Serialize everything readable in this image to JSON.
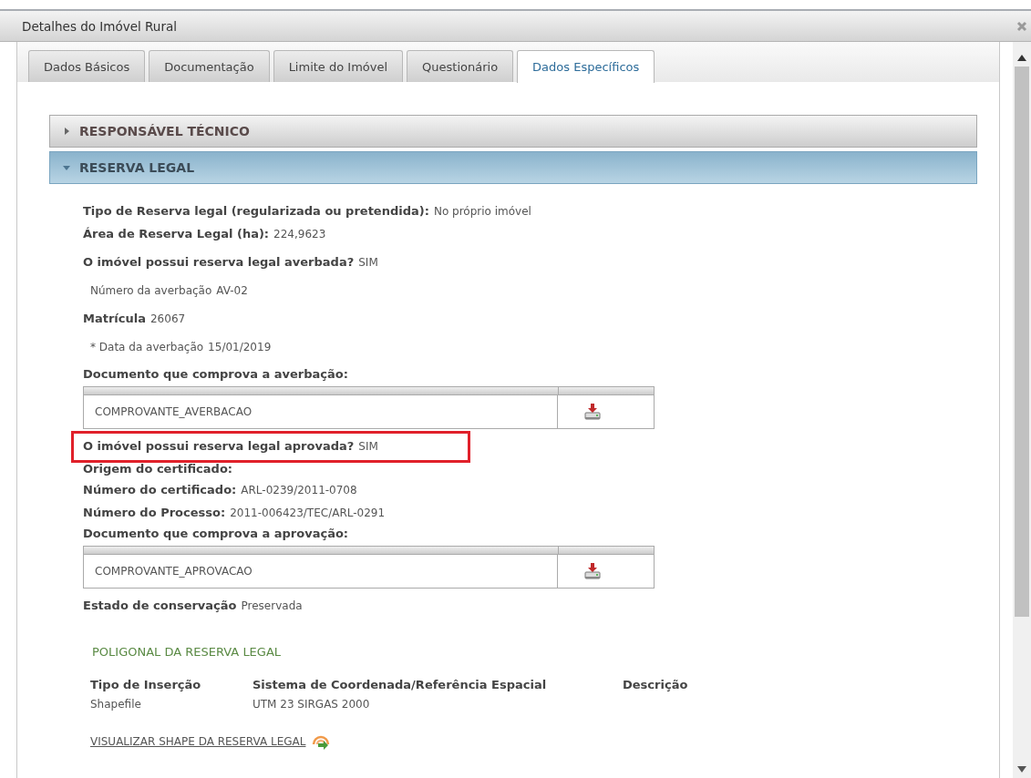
{
  "window": {
    "title": "Detalhes do Imóvel Rural"
  },
  "tabs": [
    {
      "label": "Dados Básicos",
      "selected": false
    },
    {
      "label": "Documentação",
      "selected": false
    },
    {
      "label": "Limite do Imóvel",
      "selected": false
    },
    {
      "label": "Questionário",
      "selected": false
    },
    {
      "label": "Dados Específicos",
      "selected": true
    }
  ],
  "sections": [
    {
      "title": "RESPONSÁVEL TÉCNICO",
      "expanded": false
    },
    {
      "title": "RESERVA LEGAL",
      "expanded": true
    }
  ],
  "reserva_legal": [
    {
      "items": [
        {
          "kind": "field",
          "label": "Tipo de Reserva legal (regularizada ou pretendida):",
          "value": "No próprio imóvel",
          "highlighted": false
        },
        {
          "kind": "field",
          "label": "Área de Reserva Legal (ha):",
          "value": "224,9623",
          "highlighted": false
        }
      ]
    },
    {
      "items": [
        {
          "kind": "field",
          "label": "O imóvel possui reserva legal averbada?",
          "value": "SIM",
          "highlighted": false
        }
      ]
    },
    {
      "items": [
        {
          "kind": "plain",
          "label": "Número da averbação",
          "value": "AV-02"
        }
      ]
    },
    {
      "items": [
        {
          "kind": "field",
          "label": "Matrícula",
          "value": "26067",
          "highlighted": false
        }
      ]
    },
    {
      "items": [
        {
          "kind": "plain",
          "label": "* Data da averbação",
          "value": "15/01/2019"
        }
      ]
    },
    {
      "items": [
        {
          "kind": "heading",
          "text": "Documento que comprova a averbação:"
        },
        {
          "kind": "document",
          "file": "COMPROVANTE_AVERBACAO"
        }
      ]
    },
    {
      "items": [
        {
          "kind": "field",
          "label": "O imóvel possui reserva legal aprovada?",
          "value": "SIM",
          "highlighted": true
        },
        {
          "kind": "field",
          "label": "Origem do certificado:",
          "highlighted": false
        },
        {
          "kind": "field",
          "label": "Número do certificado:",
          "value": "ARL-0239/2011-0708",
          "highlighted": false
        },
        {
          "kind": "field",
          "label": "Número do Processo:",
          "value": "2011-006423/TEC/ARL-0291",
          "highlighted": false
        },
        {
          "kind": "heading",
          "text": "Documento que comprova a aprovação:"
        },
        {
          "kind": "document",
          "file": "COMPROVANTE_APROVACAO"
        }
      ]
    },
    {
      "items": [
        {
          "kind": "field",
          "label": "Estado de conservação",
          "value": "Preservada",
          "highlighted": false
        }
      ]
    },
    {
      "items": [
        {
          "kind": "subheading",
          "text": "POLIGONAL DA RESERVA LEGAL"
        }
      ]
    },
    {
      "items": [
        {
          "kind": "grid",
          "columns": [
            "Tipo de Inserção",
            "Sistema de Coordenada/Referência Espacial",
            "Descrição"
          ],
          "rows": [
            [
              "Shapefile",
              "UTM 23 SIRGAS 2000"
            ]
          ]
        }
      ]
    },
    {
      "items": [
        {
          "kind": "link",
          "text": "VISUALIZAR SHAPE DA RESERVA LEGAL"
        }
      ]
    }
  ]
}
